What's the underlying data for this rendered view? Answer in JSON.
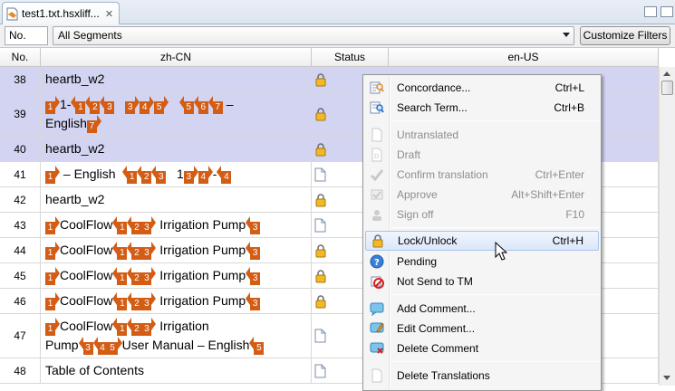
{
  "tab": {
    "title": "test1.txt.hsxliff...",
    "close": "✕"
  },
  "filter": {
    "no_placeholder": "No.",
    "segments_value": "All Segments",
    "customize_label": "Customize Filters"
  },
  "columns": {
    "no": "No.",
    "source": "zh-CN",
    "status": "Status",
    "target": "en-US"
  },
  "rows": [
    {
      "no": "38",
      "status_icon": "lock-icon",
      "selected": true
    },
    {
      "no": "39",
      "status_icon": "lock-icon",
      "selected": true
    },
    {
      "no": "40",
      "status_icon": "lock-icon",
      "selected": true,
      "text": "heartb_w2"
    },
    {
      "no": "41",
      "status_icon": "document-icon",
      "selected": false
    },
    {
      "no": "42",
      "status_icon": "lock-icon",
      "selected": false,
      "text": "heartb_w2"
    },
    {
      "no": "43",
      "status_icon": "document-icon",
      "selected": false
    },
    {
      "no": "44",
      "status_icon": "lock-icon",
      "selected": false
    },
    {
      "no": "45",
      "status_icon": "lock-icon",
      "selected": false
    },
    {
      "no": "46",
      "status_icon": "lock-icon",
      "selected": false
    },
    {
      "no": "47",
      "status_icon": "document-icon",
      "selected": false
    },
    {
      "no": "48",
      "status_icon": "document-icon",
      "selected": false,
      "text": "Table of Contents"
    }
  ],
  "segment_text": {
    "r38": "heartb_w2",
    "r39_a": "1-",
    "r39_b": "–",
    "r39_c": "English",
    "r41_a": "– English",
    "r41_b": "1",
    "r41_c": "-",
    "coolflow": "CoolFlow",
    "irrigation_pump": "Irrigation Pump",
    "irrigation": "Irrigation",
    "pump": "Pump",
    "user_manual": "User Manual – English"
  },
  "tags": [
    "1",
    "2",
    "3",
    "4",
    "5",
    "6",
    "7"
  ],
  "menu": {
    "items": [
      {
        "label": "Concordance...",
        "shortcut": "Ctrl+L",
        "icon": "concordance-icon",
        "enabled": true
      },
      {
        "label": "Search Term...",
        "shortcut": "Ctrl+B",
        "icon": "search-term-icon",
        "enabled": true
      },
      {
        "label": "Untranslated",
        "shortcut": "",
        "icon": "untranslated-icon",
        "enabled": false
      },
      {
        "label": "Draft",
        "shortcut": "",
        "icon": "draft-icon",
        "enabled": false
      },
      {
        "label": "Confirm translation",
        "shortcut": "Ctrl+Enter",
        "icon": "confirm-icon",
        "enabled": false
      },
      {
        "label": "Approve",
        "shortcut": "Alt+Shift+Enter",
        "icon": "approve-icon",
        "enabled": false
      },
      {
        "label": "Sign off",
        "shortcut": "F10",
        "icon": "sign-off-icon",
        "enabled": false
      },
      {
        "label": "Lock/Unlock",
        "shortcut": "Ctrl+H",
        "icon": "lock-icon",
        "enabled": true,
        "highlighted": true
      },
      {
        "label": "Pending",
        "shortcut": "",
        "icon": "pending-icon",
        "enabled": true
      },
      {
        "label": "Not Send to TM",
        "shortcut": "",
        "icon": "not-send-icon",
        "enabled": true
      },
      {
        "label": "Add Comment...",
        "shortcut": "",
        "icon": "add-comment-icon",
        "enabled": true
      },
      {
        "label": "Edit Comment...",
        "shortcut": "",
        "icon": "edit-comment-icon",
        "enabled": true
      },
      {
        "label": "Delete Comment",
        "shortcut": "",
        "icon": "delete-comment-icon",
        "enabled": true
      },
      {
        "label": "Delete Translations",
        "shortcut": "",
        "icon": "delete-translations-icon",
        "enabled": true
      }
    ]
  },
  "colors": {
    "selected_row": "#d2d4f2",
    "tag": "#d35d15",
    "menu_highlight": "#dbe7fa"
  }
}
